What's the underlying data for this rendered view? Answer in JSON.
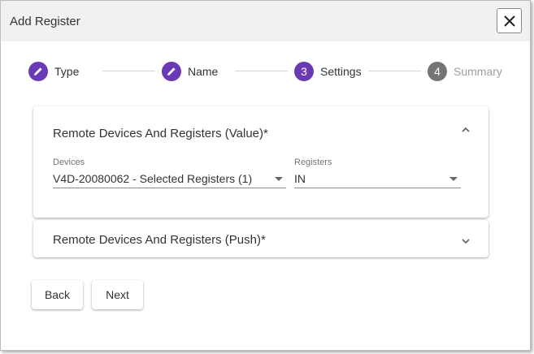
{
  "dialog": {
    "title": "Add Register",
    "close_icon": "close-icon"
  },
  "colors": {
    "accent": "#6a3ab5",
    "inactive_step": "#757575",
    "titlebar_bg": "#f1f1f1"
  },
  "stepper": {
    "steps": [
      {
        "number": "",
        "label": "Type",
        "state": "completed",
        "icon": "pencil-icon"
      },
      {
        "number": "",
        "label": "Name",
        "state": "completed",
        "icon": "pencil-icon"
      },
      {
        "number": "3",
        "label": "Settings",
        "state": "active"
      },
      {
        "number": "4",
        "label": "Summary",
        "state": "inactive"
      }
    ]
  },
  "panels": {
    "value": {
      "title": "Remote Devices And Registers (Value)*",
      "expanded": true,
      "devices": {
        "caption": "Devices",
        "value": "V4D-20080062 - Selected Registers (1)"
      },
      "registers": {
        "caption": "Registers",
        "value": "IN"
      }
    },
    "push": {
      "title": "Remote Devices And Registers (Push)*",
      "expanded": false
    }
  },
  "actions": {
    "back_label": "Back",
    "next_label": "Next"
  }
}
